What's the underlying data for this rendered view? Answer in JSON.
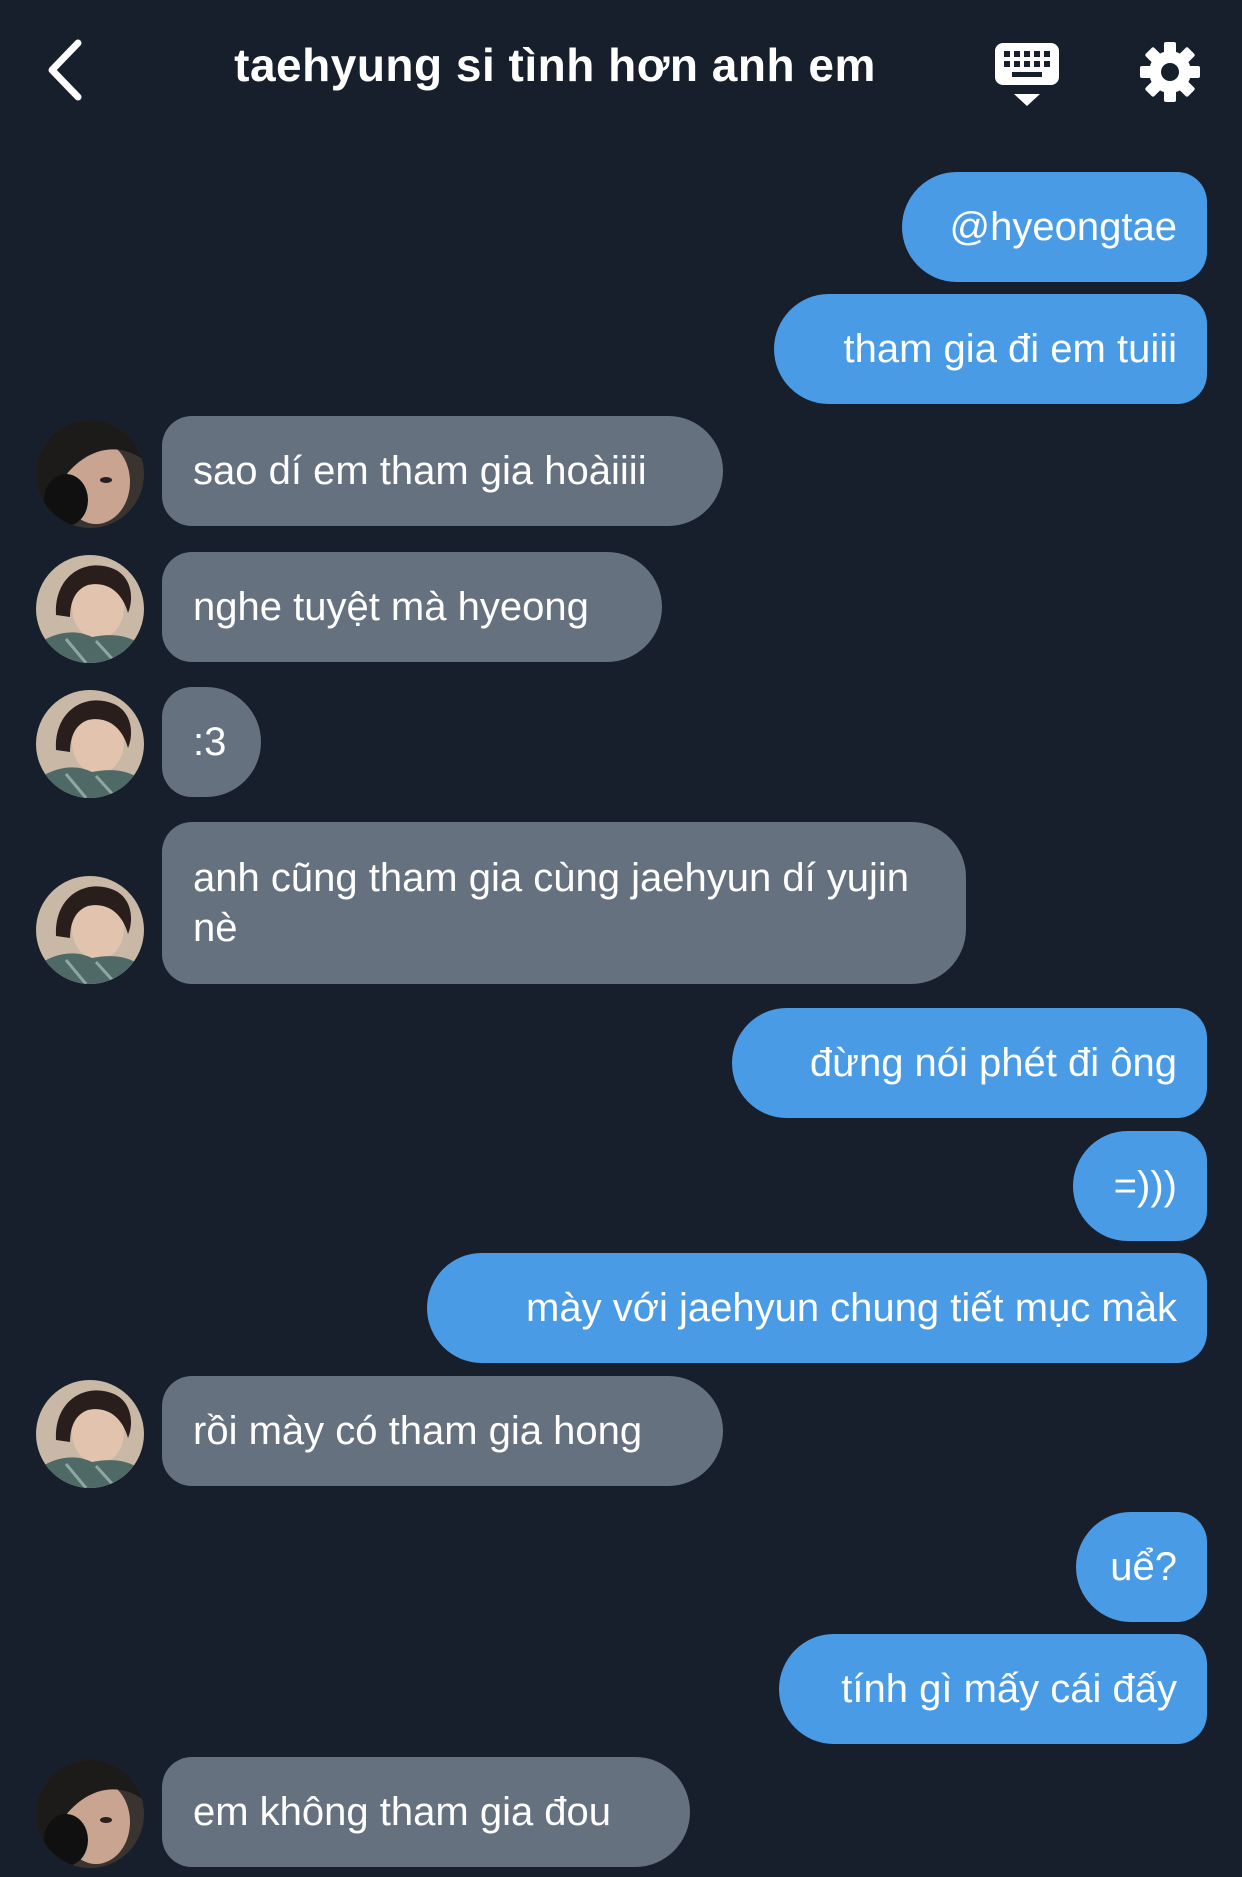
{
  "header": {
    "title": "taehyung si tình hơn anh em",
    "icons": {
      "back": "chevron-left-icon",
      "keyboard": "keyboard-icon",
      "settings": "gear-icon"
    }
  },
  "colors": {
    "background": "#161f2b",
    "outgoing_bubble": "#4a9be6",
    "incoming_bubble": "#667180",
    "text": "#ffffff"
  },
  "messages": [
    {
      "sender": "me",
      "text": "@hyeongtae"
    },
    {
      "sender": "me",
      "text": "tham gia đi em tuiii"
    },
    {
      "sender": "other",
      "text": "sao dí em tham gia hoàiiii"
    },
    {
      "sender": "other",
      "text": "nghe tuyệt mà hyeong"
    },
    {
      "sender": "other",
      "text": ":3"
    },
    {
      "sender": "other",
      "text": "anh cũng tham gia cùng jaehyun dí yujin nè"
    },
    {
      "sender": "me",
      "text": "đừng nói phét đi ông"
    },
    {
      "sender": "me",
      "text": "=)))"
    },
    {
      "sender": "me",
      "text": "mày với jaehyun chung tiết mục màk"
    },
    {
      "sender": "other",
      "text": "rồi mày có tham gia hong"
    },
    {
      "sender": "me",
      "text": "uể?"
    },
    {
      "sender": "me",
      "text": "tính gì mấy cái đấy"
    },
    {
      "sender": "other",
      "text": "em không tham gia đou"
    }
  ]
}
